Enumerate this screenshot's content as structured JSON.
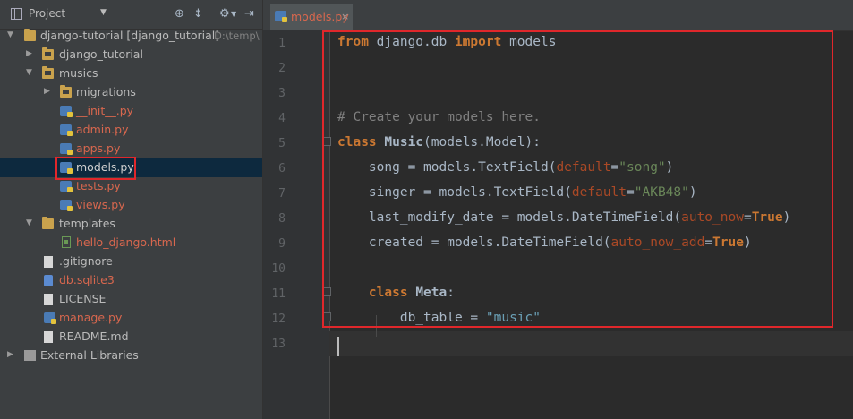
{
  "colors": {
    "highlight": "#e0272b",
    "accent_file": "#d8674e",
    "bg": "#2b2b2b",
    "sidebar_bg": "#3c3f41"
  },
  "sidebar": {
    "header": {
      "label": "Project",
      "icons": [
        "target-icon",
        "collapse-icon",
        "settings-icon",
        "hide-icon"
      ]
    },
    "tree": [
      {
        "label": "django-tutorial [django_tutorial]",
        "path": "D:\\temp\\",
        "type": "folder",
        "expanded": true,
        "level": 0
      },
      {
        "label": "django_tutorial",
        "type": "folder",
        "expanded": false,
        "level": 1
      },
      {
        "label": "musics",
        "type": "folder",
        "expanded": true,
        "level": 1
      },
      {
        "label": "migrations",
        "type": "folder",
        "expanded": false,
        "level": 2
      },
      {
        "label": "__init__.py",
        "type": "py",
        "level": 3,
        "modified": true
      },
      {
        "label": "admin.py",
        "type": "py",
        "level": 3,
        "modified": true
      },
      {
        "label": "apps.py",
        "type": "py",
        "level": 3,
        "modified": true
      },
      {
        "label": "models.py",
        "type": "py",
        "level": 3,
        "modified": false,
        "selected": true,
        "highlighted": true
      },
      {
        "label": "tests.py",
        "type": "py",
        "level": 3,
        "modified": true
      },
      {
        "label": "views.py",
        "type": "py",
        "level": 3,
        "modified": true
      },
      {
        "label": "templates",
        "type": "folder",
        "expanded": true,
        "level": 1
      },
      {
        "label": "hello_django.html",
        "type": "html",
        "level": 3,
        "modified": true
      },
      {
        "label": ".gitignore",
        "type": "file",
        "level": 2,
        "modified": false
      },
      {
        "label": "db.sqlite3",
        "type": "db",
        "level": 2,
        "modified": true
      },
      {
        "label": "LICENSE",
        "type": "file",
        "level": 2,
        "modified": false
      },
      {
        "label": "manage.py",
        "type": "py",
        "level": 2,
        "modified": true
      },
      {
        "label": "README.md",
        "type": "file",
        "level": 2,
        "modified": false
      },
      {
        "label": "External Libraries",
        "type": "lib",
        "expanded": false,
        "level": 0
      }
    ]
  },
  "editor": {
    "tab": {
      "label": "models.py",
      "close": "×"
    },
    "line_numbers": [
      "1",
      "2",
      "3",
      "4",
      "5",
      "6",
      "7",
      "8",
      "9",
      "10",
      "11",
      "12",
      "13"
    ],
    "code": {
      "l1_a": "from",
      "l1_b": " django.db ",
      "l1_c": "import",
      "l1_d": " models",
      "l4": "# Create your models here.",
      "l5_a": "class",
      "l5_b": " ",
      "l5_c": "Music",
      "l5_d": "(models.Model):",
      "l6_a": "    song = models.TextField(",
      "l6_b": "default",
      "l6_c": "=",
      "l6_d": "\"song\"",
      "l6_e": ")",
      "l7_a": "    singer = models.TextField(",
      "l7_b": "default",
      "l7_c": "=",
      "l7_d": "\"AKB48\"",
      "l7_e": ")",
      "l8_a": "    last_modify_date = models.DateTimeField(",
      "l8_b": "auto_now",
      "l8_c": "=",
      "l8_d": "True",
      "l8_e": ")",
      "l9_a": "    created = models.DateTimeField(",
      "l9_b": "auto_now_add",
      "l9_c": "=",
      "l9_d": "True",
      "l9_e": ")",
      "l11_a": "    ",
      "l11_b": "class",
      "l11_c": " ",
      "l11_d": "Meta",
      "l11_e": ":",
      "l12_a": "        db_table = ",
      "l12_b": "\"music\""
    }
  }
}
